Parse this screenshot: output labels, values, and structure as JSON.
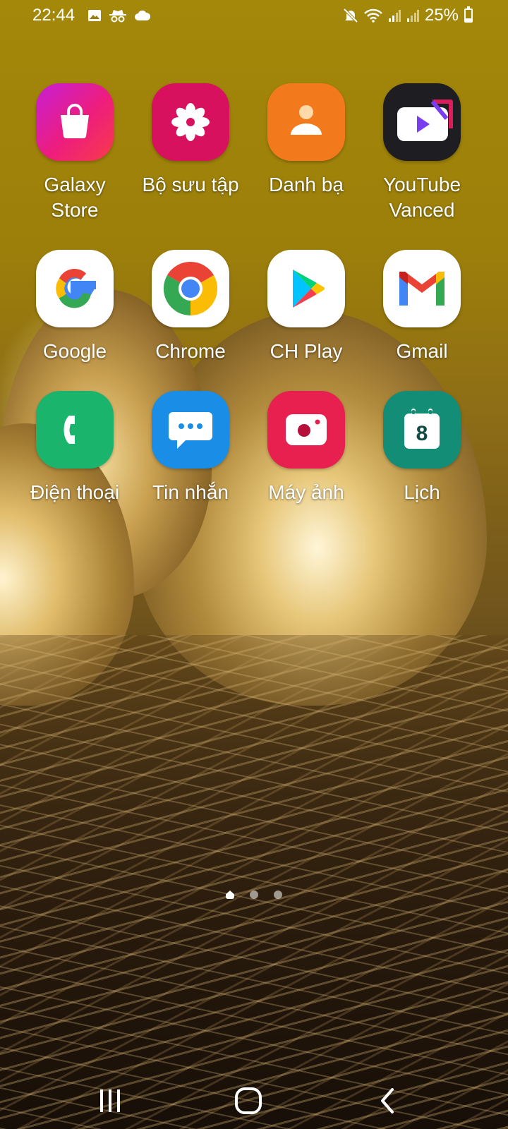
{
  "status_bar": {
    "time": "22:44",
    "left_icons": [
      "image-icon",
      "incognito-icon",
      "cloud-icon"
    ],
    "right_icons": [
      "mute-icon",
      "wifi-icon",
      "signal-icon",
      "signal-icon"
    ],
    "battery": "25%",
    "battery_level": 0.25
  },
  "apps": [
    {
      "label": "Galaxy\nStore",
      "icon": "shopping-bag-icon",
      "color": "#e21d8f"
    },
    {
      "label": "Bộ sưu tập",
      "icon": "flower-icon",
      "color": "#d8115f"
    },
    {
      "label": "Danh bạ",
      "icon": "person-icon",
      "color": "#f37a1c"
    },
    {
      "label": "YouTube\nVanced",
      "icon": "youtube-vanced-icon",
      "color": "#1d1d22"
    },
    {
      "label": "Google",
      "icon": "google-g-icon",
      "color": "#ffffff"
    },
    {
      "label": "Chrome",
      "icon": "chrome-icon",
      "color": "#ffffff"
    },
    {
      "label": "CH Play",
      "icon": "play-store-icon",
      "color": "#ffffff"
    },
    {
      "label": "Gmail",
      "icon": "gmail-icon",
      "color": "#ffffff"
    },
    {
      "label": "Điện thoại",
      "icon": "phone-icon",
      "color": "#1bb46d"
    },
    {
      "label": "Tin nhắn",
      "icon": "message-icon",
      "color": "#1a8ee6"
    },
    {
      "label": "Máy ảnh",
      "icon": "camera-icon",
      "color": "#e8204f"
    },
    {
      "label": "Lịch",
      "icon": "calendar-icon",
      "color": "#148d77",
      "calendar_day": "8"
    }
  ],
  "page_indicator": {
    "pages": 3,
    "current": 1
  },
  "nav_bar": {
    "buttons": [
      "recents-icon",
      "home-icon",
      "back-icon"
    ]
  }
}
